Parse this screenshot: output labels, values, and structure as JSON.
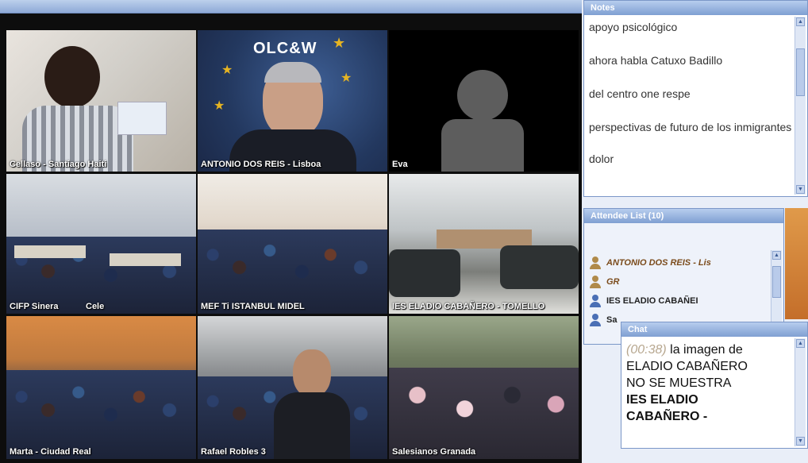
{
  "video_window": {
    "title": "",
    "tiles": [
      {
        "caption": "Cellaso - Santiago Haiti"
      },
      {
        "caption": "ANTONIO DOS REIS - Lisboa",
        "banner": "OLC&W"
      },
      {
        "caption": "Eva"
      },
      {
        "caption": "CIFP Sinera",
        "caption2": "Cele"
      },
      {
        "caption": "MEF Ti ISTANBUL MIDEL"
      },
      {
        "caption": "IES ELADIO CABAÑERO - TOMELLO"
      },
      {
        "caption": "Marta - Ciudad Real"
      },
      {
        "caption": "Rafael Robles 3"
      },
      {
        "caption": "Salesianos Granada"
      }
    ]
  },
  "notes_panel": {
    "title": "Notes",
    "items": [
      "apoyo psicológico",
      "ahora habla Catuxo Badillo",
      "del centro one respe",
      "perspectivas de futuro de los inmigrantes",
      "dolor"
    ]
  },
  "attendees_panel": {
    "title": "Attendee List (10)",
    "items": [
      {
        "name": "ANTONIO DOS REIS - Lis",
        "role": "host",
        "color": "#b08a4a"
      },
      {
        "name": "GR",
        "role": "host",
        "color": "#b08a4a"
      },
      {
        "name": "IES ELADIO CABAÑEI",
        "role": "participant",
        "color": "#4a6fb5"
      },
      {
        "name": "Sa",
        "role": "participant",
        "color": "#4a6fb5"
      }
    ]
  },
  "chat_panel": {
    "title": "Chat",
    "time": "(00:38)",
    "message_line1": "la imagen de",
    "message_line2": "ELADIO CABAÑERO",
    "message_line3": "NO SE MUESTRA",
    "bold_line1": "IES ELADIO",
    "bold_line2": "CABAÑERO -"
  }
}
